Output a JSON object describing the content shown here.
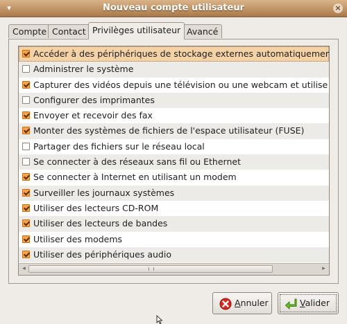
{
  "window": {
    "title": "Nouveau compte utilisateur"
  },
  "tabs": [
    {
      "label": "Compte",
      "active": false
    },
    {
      "label": "Contact",
      "active": false
    },
    {
      "label": "Privilèges utilisateur",
      "active": true
    },
    {
      "label": "Avancé",
      "active": false
    }
  ],
  "privileges": [
    {
      "label": "Accéder à des périphériques de stockage externes automatiquemen",
      "checked": true,
      "selected": true
    },
    {
      "label": "Administrer le système",
      "checked": false
    },
    {
      "label": "Capturer des vidéos depuis une télévision ou une webcam et utilise",
      "checked": true
    },
    {
      "label": "Configurer des imprimantes",
      "checked": false
    },
    {
      "label": "Envoyer et recevoir des fax",
      "checked": true
    },
    {
      "label": "Monter des systèmes de fichiers de l'espace utilisateur (FUSE)",
      "checked": true
    },
    {
      "label": "Partager des fichiers sur le réseau local",
      "checked": false
    },
    {
      "label": "Se connecter à des réseaux sans fil ou Ethernet",
      "checked": false
    },
    {
      "label": "Se connecter à Internet en utilisant un modem",
      "checked": true
    },
    {
      "label": "Surveiller les journaux systèmes",
      "checked": true
    },
    {
      "label": "Utiliser des lecteurs CD-ROM",
      "checked": true
    },
    {
      "label": "Utiliser des lecteurs de bandes",
      "checked": true
    },
    {
      "label": "Utiliser des modems",
      "checked": true
    },
    {
      "label": "Utiliser des périphériques audio",
      "checked": true
    }
  ],
  "buttons": {
    "cancel": {
      "label_mnemonic": "A",
      "label_rest": "nnuler",
      "icon": "cancel-icon"
    },
    "ok": {
      "label_mnemonic": "V",
      "label_rest": "alider",
      "icon": "ok-arrow-icon"
    }
  },
  "colors": {
    "titlebar": "#c49a6c",
    "checkbox_checked": "#f5a44a",
    "selected_row": "#f4d2a6"
  }
}
